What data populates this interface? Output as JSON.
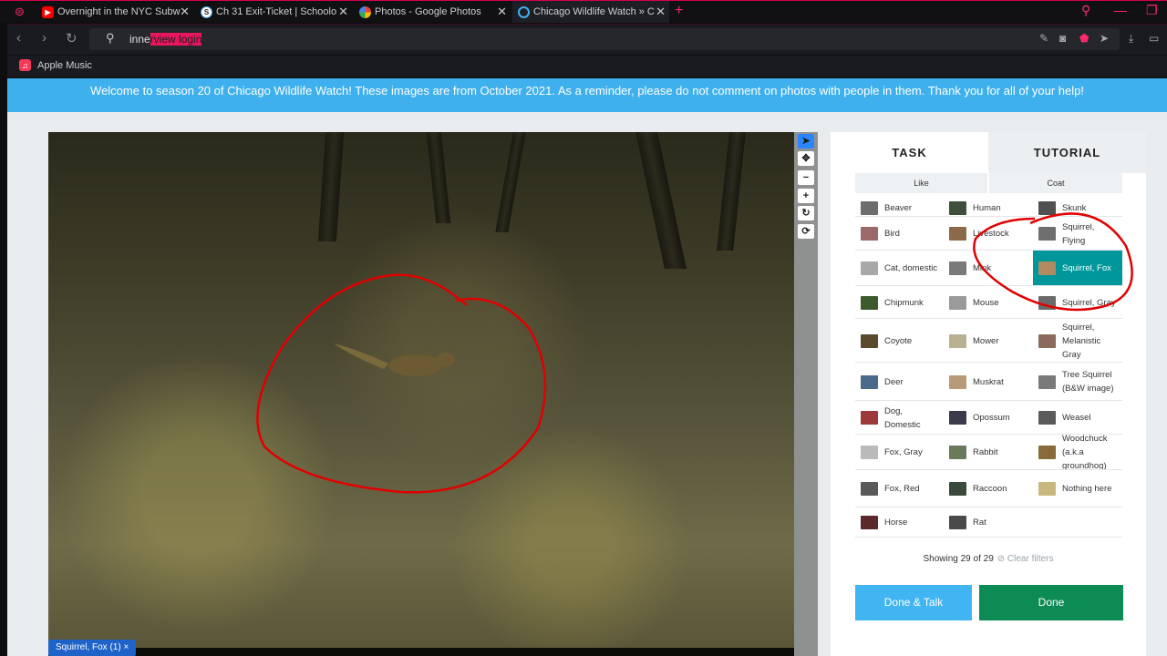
{
  "browser": {
    "tabs": [
      {
        "title": "Overnight in the NYC Subw",
        "icon_color": "#ff0000"
      },
      {
        "title": "Ch 31 Exit-Ticket | Schoolo",
        "icon_color": "#3aa0e0"
      },
      {
        "title": "Photos - Google Photos",
        "icon_color": "#fbbc05"
      },
      {
        "title": "Chicago Wildlife Watch » C",
        "icon_color": "#3fb0ee"
      }
    ],
    "address": {
      "typed": "inne",
      "highlight": "rview login"
    },
    "bookmark": "Apple Music"
  },
  "banner": "Welcome to season 20 of Chicago Wildlife Watch! These images are from October 2021. As a reminder, please do not comment on photos with people in them. Thank you for all of your help!",
  "viewer": {
    "tools": [
      "pointer-icon",
      "move-icon",
      "zoom-out-icon",
      "zoom-in-icon",
      "rotate-icon",
      "reset-icon"
    ],
    "chip": "Squirrel, Fox (1) ×"
  },
  "task": {
    "tab_task": "TASK",
    "tab_tutorial": "TUTORIAL",
    "filters": [
      "Like",
      "Coat"
    ],
    "species": [
      {
        "label": "Beaver",
        "color": "#6d6d6d"
      },
      {
        "label": "Human",
        "color": "#3e4f3a"
      },
      {
        "label": "Skunk",
        "color": "#505050"
      },
      {
        "label": "Bird",
        "color": "#9a6a6a"
      },
      {
        "label": "Livestock",
        "color": "#8a6a48"
      },
      {
        "label": "Squirrel, Flying",
        "color": "#6f6f6f"
      },
      {
        "label": "Cat, domestic",
        "color": "#a8a8a8"
      },
      {
        "label": "Mink",
        "color": "#7a7a7a"
      },
      {
        "label": "Squirrel, Fox",
        "color": "#b08a60"
      },
      {
        "label": "Chipmunk",
        "color": "#3c5a2e"
      },
      {
        "label": "Mouse",
        "color": "#9a9a9a"
      },
      {
        "label": "Squirrel, Gray",
        "color": "#6a6a6a"
      },
      {
        "label": "Coyote",
        "color": "#5a4a2e"
      },
      {
        "label": "Mower",
        "color": "#b8b090"
      },
      {
        "label": "Squirrel, Melanistic Gray",
        "color": "#8a6a5a"
      },
      {
        "label": "Deer",
        "color": "#4a6a8a"
      },
      {
        "label": "Muskrat",
        "color": "#b89a78"
      },
      {
        "label": "Tree Squirrel (B&W image)",
        "color": "#7a7a7a"
      },
      {
        "label": "Dog, Domestic",
        "color": "#9a3a3a"
      },
      {
        "label": "Opossum",
        "color": "#3a3a4a"
      },
      {
        "label": "Weasel",
        "color": "#5a5a5a"
      },
      {
        "label": "Fox, Gray",
        "color": "#bababa"
      },
      {
        "label": "Rabbit",
        "color": "#6a7a5a"
      },
      {
        "label": "Woodchuck (a.k.a groundhog)",
        "color": "#8a6a3a"
      },
      {
        "label": "Fox, Red",
        "color": "#5a5a5a"
      },
      {
        "label": "Raccoon",
        "color": "#3a4a3a"
      },
      {
        "label": "Nothing here",
        "color": "#c8b880"
      },
      {
        "label": "Horse",
        "color": "#5a2a2a"
      },
      {
        "label": "Rat",
        "color": "#4a4a4a"
      }
    ],
    "selected": "Squirrel, Fox",
    "showing": "Showing 29 of 29",
    "clear_filters": "⊘ Clear filters",
    "btn_talk": "Done & Talk",
    "btn_done": "Done"
  },
  "colors": {
    "accent": "#3fb0ee",
    "selected": "#00979a",
    "done": "#0d8b55",
    "annotation": "#e00000"
  }
}
